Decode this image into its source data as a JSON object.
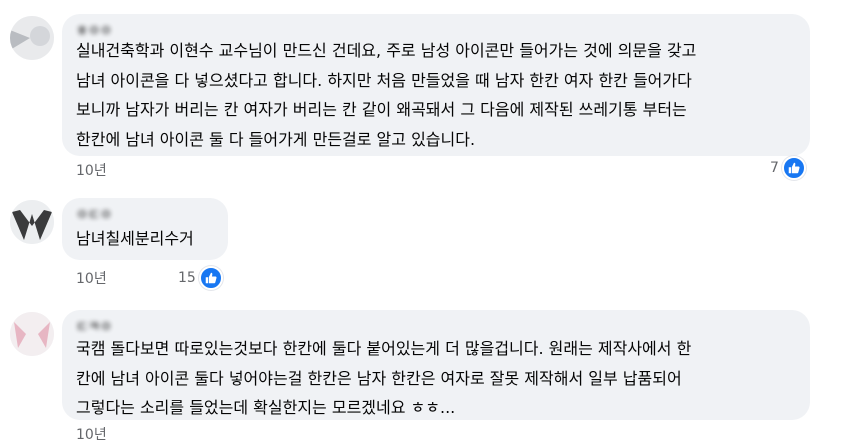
{
  "comments": [
    {
      "author": "ㅎㅇㅇ",
      "lines": [
        "실내건축학과 이현수 교수님이 만드신 건데요, 주로 남성 아이콘만 들어가는 것에 의문을 갖고",
        "남녀 아이콘을 다 넣으셨다고 합니다. 하지만 처음 만들었을 때 남자 한칸 여자 한칸 들어가다",
        "보니까 남자가 버리는 칸 여자가 버리는 칸 같이 왜곡돼서 그 다음에 제작된 쓰레기통 부터는",
        "한칸에 남녀 아이콘 둘 다 들어가게 만든걸로 알고 있습니다."
      ],
      "time": "10년",
      "like_count": "7"
    },
    {
      "author": "ㅇㄷㅇ",
      "lines": [
        "남녀칠세분리수거"
      ],
      "time": "10년",
      "like_count": "15"
    },
    {
      "author": "ㄷㅋㅇ",
      "lines": [
        "국캠 돌다보면 따로있는것보다 한칸에 둘다 붙어있는게 더 많을겁니다. 원래는 제작사에서 한",
        "칸에 남녀 아이콘 둘다 넣어야는걸 한칸은 남자 한칸은 여자로 잘못 제작해서 일부 납품되어",
        "그렇다는 소리를 들었는데 확실한지는 모르겠네요 ㅎㅎ..."
      ],
      "time": "10년"
    }
  ],
  "colors": {
    "bubble": "#f0f2f5",
    "like_blue": "#1877f2",
    "meta_gray": "#65676b"
  },
  "icons": [
    "avatar",
    "like-icon"
  ]
}
